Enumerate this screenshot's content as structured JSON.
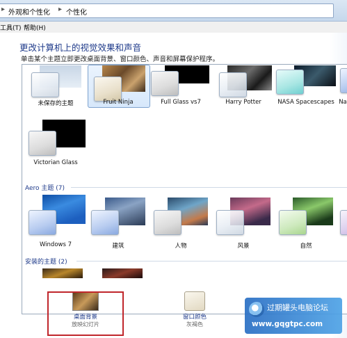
{
  "breadcrumb": {
    "items": [
      "外观和个性化",
      "个性化"
    ],
    "separator": "▸"
  },
  "menu": {
    "tools": "工具(T)",
    "help": "帮助(H)"
  },
  "main": {
    "title": "更改计算机上的视觉效果和声音",
    "subtitle": "单击某个主题立即更改桌面背景、窗口颜色、声音和屏幕保护程序。"
  },
  "my_themes": [
    {
      "label": "未保存的主题",
      "selected": false
    },
    {
      "label": "Fruit Ninja",
      "selected": true
    },
    {
      "label": "Full Glass vs7",
      "selected": false
    },
    {
      "label": "Harry Potter",
      "selected": false
    },
    {
      "label": "NASA Spacescapes",
      "selected": false
    },
    {
      "label": "Na",
      "selected": false
    },
    {
      "label": "Victorian Glass",
      "selected": false
    }
  ],
  "aero": {
    "heading": "Aero 主题 (7)",
    "themes": [
      {
        "label": "Windows 7"
      },
      {
        "label": "建筑"
      },
      {
        "label": "人物"
      },
      {
        "label": "风景"
      },
      {
        "label": "自然"
      }
    ]
  },
  "installed": {
    "heading": "安装的主题 (2)"
  },
  "bottom": {
    "background_label": "桌面背景",
    "background_sub": "放映幻灯片",
    "color_label": "窗口颜色",
    "color_sub": "灰褐色"
  },
  "watermark": {
    "title": "过期罐头电脑论坛",
    "url": "www.gqgtpc.com"
  },
  "colors": {
    "accent_blue": "#1e3a8a",
    "highlight_red": "#c0262b",
    "selection": "#d7e8fb"
  }
}
